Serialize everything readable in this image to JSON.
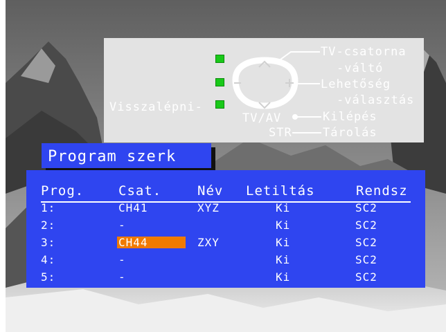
{
  "help": {
    "tv_channel_line1": "TV-csatorna",
    "tv_channel_line2": "-váltó",
    "option_line1": "Lehetőség",
    "option_line2": "-választás",
    "back": "Visszalépni-",
    "tvav": "TV/AV",
    "exit": "Kilépés",
    "str": "STR",
    "store": "Tárolás"
  },
  "menu": {
    "title": "Program szerk"
  },
  "table": {
    "headers": [
      "Prog.",
      "Csat.",
      "Név",
      "Letiltás",
      "Rendsz"
    ],
    "rows": [
      {
        "prog": "1:",
        "csat": "CH41",
        "nev": "XYZ",
        "letiltas": "Ki",
        "rendsz": "SC2"
      },
      {
        "prog": "2:",
        "csat": "-",
        "nev": "",
        "letiltas": "Ki",
        "rendsz": "SC2"
      },
      {
        "prog": "3:",
        "csat": "CH44",
        "nev": "ZXY",
        "letiltas": "Ki",
        "rendsz": "SC2",
        "selected": true
      },
      {
        "prog": "4:",
        "csat": "-",
        "nev": "",
        "letiltas": "Ki",
        "rendsz": "SC2"
      },
      {
        "prog": "5:",
        "csat": "-",
        "nev": "",
        "letiltas": "Ki",
        "rendsz": "SC2"
      }
    ]
  },
  "colors": {
    "panel_blue": "#2f45f0",
    "highlight_orange": "#f07a00",
    "help_panel": "#e3e3e3",
    "led_green": "#19c919"
  },
  "icons": [
    "mountain-background",
    "remote-dpad-icon",
    "green-led-icon"
  ]
}
